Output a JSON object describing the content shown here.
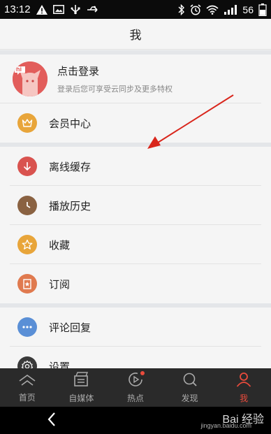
{
  "status_bar": {
    "time": "13:12",
    "battery": "56",
    "left_icons": [
      "warning-icon",
      "image-icon",
      "usb-icon",
      "usb-debug-icon"
    ],
    "right_icons": [
      "bluetooth-icon",
      "alarm-icon",
      "wifi-icon",
      "signal-icon",
      "battery-icon"
    ]
  },
  "header": {
    "title": "我"
  },
  "login": {
    "title": "点击登录",
    "subtitle": "登录后您可享受云同步及更多特权",
    "avatar_badge": "hi"
  },
  "menu": {
    "vip": {
      "label": "会员中心",
      "icon": "crown-icon",
      "color": "#e8a53a"
    },
    "offline": {
      "label": "离线缓存",
      "icon": "download-icon",
      "color": "#d9534f"
    },
    "history": {
      "label": "播放历史",
      "icon": "clock-icon",
      "color": "#8a6242"
    },
    "favorites": {
      "label": "收藏",
      "icon": "star-icon",
      "color": "#e8a53a"
    },
    "subscribe": {
      "label": "订阅",
      "icon": "bookmark-icon",
      "color": "#e07a4f"
    },
    "comments": {
      "label": "评论回复",
      "icon": "chat-icon",
      "color": "#5a8fd6"
    },
    "settings": {
      "label": "设置",
      "icon": "gear-icon",
      "color": "#3a3a3a"
    }
  },
  "tabs": [
    {
      "label": "首页",
      "icon": "home-icon"
    },
    {
      "label": "自媒体",
      "icon": "media-icon"
    },
    {
      "label": "热点",
      "icon": "play-icon",
      "has_dot": true
    },
    {
      "label": "发现",
      "icon": "search-icon"
    },
    {
      "label": "我",
      "icon": "user-icon",
      "active": true
    }
  ],
  "colors": {
    "accent": "#e94b3c",
    "tab_bar": "#2a2a2a"
  },
  "watermark": {
    "text": "Bai 经验",
    "sub": "jingyan.baidu.com"
  }
}
